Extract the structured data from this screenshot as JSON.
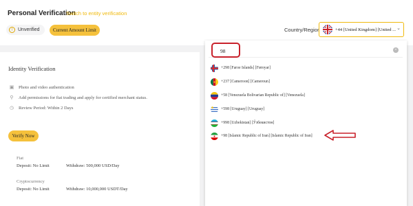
{
  "header": {
    "title": "Personal Verification",
    "switch_link": "Switch to entity verification",
    "status_badge": "Unverified",
    "limit_button": "Current Amount Limit",
    "country_label": "Country/Region",
    "country_value": "+44 [United Kingdom] [United ..."
  },
  "identity": {
    "title": "Identity Verification",
    "features": [
      "Photo and video authentication",
      "Add permissions for fiat trading and apply for certified merchant status.",
      "Review Period: Within 2 Days"
    ],
    "verify_button": "Verify Now",
    "fiat": {
      "label": "Fiat",
      "deposit": "Deposit: No Limit",
      "withdraw": "Withdraw: 500,000 USD/Day"
    },
    "crypto": {
      "label": "Cryptocurrency",
      "deposit": "Deposit: No Limit",
      "withdraw": "Withdraw: 10,000,000 USDT/Day"
    }
  },
  "dropdown": {
    "search_value": "98",
    "options": [
      {
        "label": "+298 [Faroe Islands] [Føroyar]",
        "flag": "faroe"
      },
      {
        "label": "+237 [Cameroon] [Cameroun]",
        "flag": "cameroon"
      },
      {
        "label": "+58 [Venezuela Bolivarian Republic of] [Venezuela]",
        "flag": "venezuela"
      },
      {
        "label": "+598 [Uruguay] [Uruguay]",
        "flag": "uruguay"
      },
      {
        "label": "+998 [Uzbekistan] [Ўзбекистон]",
        "flag": "uzbekistan"
      },
      {
        "label": "+98 [Islamic Republic of Iran] [Islamic Republic of Iran]",
        "flag": "iran"
      }
    ]
  },
  "colors": {
    "accent": "#f5c13c",
    "link": "#f0b90b",
    "annotation": "#c8202a"
  }
}
